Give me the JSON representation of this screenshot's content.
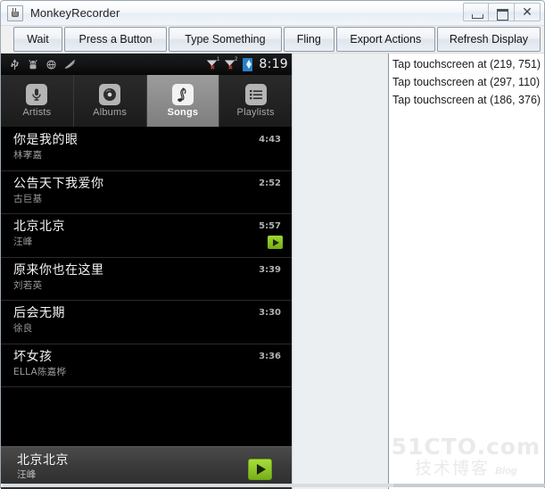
{
  "window": {
    "title": "MonkeyRecorder",
    "app_icon": "java-coffee-cup-icon",
    "controls": [
      {
        "name": "minimize",
        "glyph": "minimize-icon"
      },
      {
        "name": "maximize",
        "glyph": "maximize-icon"
      },
      {
        "name": "close",
        "glyph": "close-icon",
        "label": "✕"
      }
    ]
  },
  "toolbar": {
    "buttons": [
      {
        "label": "Wait",
        "name": "wait-button"
      },
      {
        "label": "Press a Button",
        "name": "press-a-button-button"
      },
      {
        "label": "Type Something",
        "name": "type-something-button"
      },
      {
        "label": "Fling",
        "name": "fling-button"
      },
      {
        "label": "Export Actions",
        "name": "export-actions-button"
      },
      {
        "label": "Refresh Display",
        "name": "refresh-display-button"
      }
    ]
  },
  "device": {
    "status_bar": {
      "time": "8:19",
      "left_icons": [
        "usb-icon",
        "android-debug-icon",
        "sync-icon",
        "silent-mode-icon"
      ],
      "signals": [
        {
          "label": "1",
          "state": "x"
        },
        {
          "label": "2",
          "state": "x"
        }
      ],
      "battery_icon": "battery-charging-icon"
    },
    "tabs": [
      {
        "label": "Artists",
        "icon": "microphone-icon",
        "glyph": "♉",
        "selected": false
      },
      {
        "label": "Albums",
        "icon": "disc-icon",
        "glyph": "◉",
        "selected": false
      },
      {
        "label": "Songs",
        "icon": "music-note-icon",
        "glyph": "♬",
        "selected": true
      },
      {
        "label": "Playlists",
        "icon": "list-icon",
        "glyph": "☰",
        "selected": false
      }
    ],
    "songs": [
      {
        "title": "你是我的眼",
        "artist": "林宯嘉",
        "duration": "4:43",
        "playing": false
      },
      {
        "title": "公告天下我爱你",
        "artist": "古巨基",
        "duration": "2:52",
        "playing": false
      },
      {
        "title": "北京北京",
        "artist": "汪峰",
        "duration": "5:57",
        "playing": true
      },
      {
        "title": "原来你也在这里",
        "artist": "刘若英",
        "duration": "3:39",
        "playing": false
      },
      {
        "title": "后会无期",
        "artist": "徐良",
        "duration": "3:30",
        "playing": false
      },
      {
        "title": "坏女孩",
        "artist": "ELLA陈嘉桦",
        "duration": "3:36",
        "playing": false
      }
    ],
    "now_playing": {
      "title": "北京北京",
      "artist": "汪峰",
      "play_icon": "play-icon"
    }
  },
  "log": {
    "entries": [
      "Tap touchscreen at (219, 751)",
      "Tap touchscreen at (297, 110)",
      "Tap touchscreen at (186, 376)"
    ]
  },
  "watermark": {
    "top": "51CTO.com",
    "bottom": "技术博客",
    "blog": "Blog"
  }
}
